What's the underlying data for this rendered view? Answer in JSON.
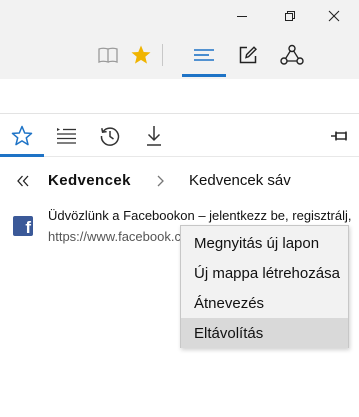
{
  "window_controls": {
    "minimize_icon": "minimize-icon",
    "restore_icon": "restore-icon",
    "close_icon": "close-icon"
  },
  "toolbar": {
    "reading_view_icon": "book-icon",
    "favorite_star_icon": "star-icon",
    "hub_icon": "hub-icon",
    "web_note_icon": "pen-icon",
    "share_icon": "share-icon",
    "accent_color": "#1e73c6",
    "star_color": "#f0b400"
  },
  "hub_tabs": [
    {
      "name": "favorites",
      "icon": "star-icon",
      "active": true
    },
    {
      "name": "reading-list",
      "icon": "reading-list-icon",
      "active": false
    },
    {
      "name": "history",
      "icon": "history-icon",
      "active": false
    },
    {
      "name": "downloads",
      "icon": "download-icon",
      "active": false
    }
  ],
  "pin_icon": "pin-icon",
  "breadcrumb": {
    "current": "Kedvencek",
    "next": "Kedvencek sáv"
  },
  "favorite_item": {
    "title": "Üdvözlünk a Facebookon – jelentkezz be, regisztrálj,",
    "url": "https://www.facebook.com/",
    "favicon_letter": "f",
    "favicon_color": "#3b5998"
  },
  "context_menu": {
    "items": [
      "Megnyitás új lapon",
      "Új mappa létrehozása",
      "Átnevezés",
      "Eltávolítás"
    ],
    "highlighted_index": 3
  }
}
